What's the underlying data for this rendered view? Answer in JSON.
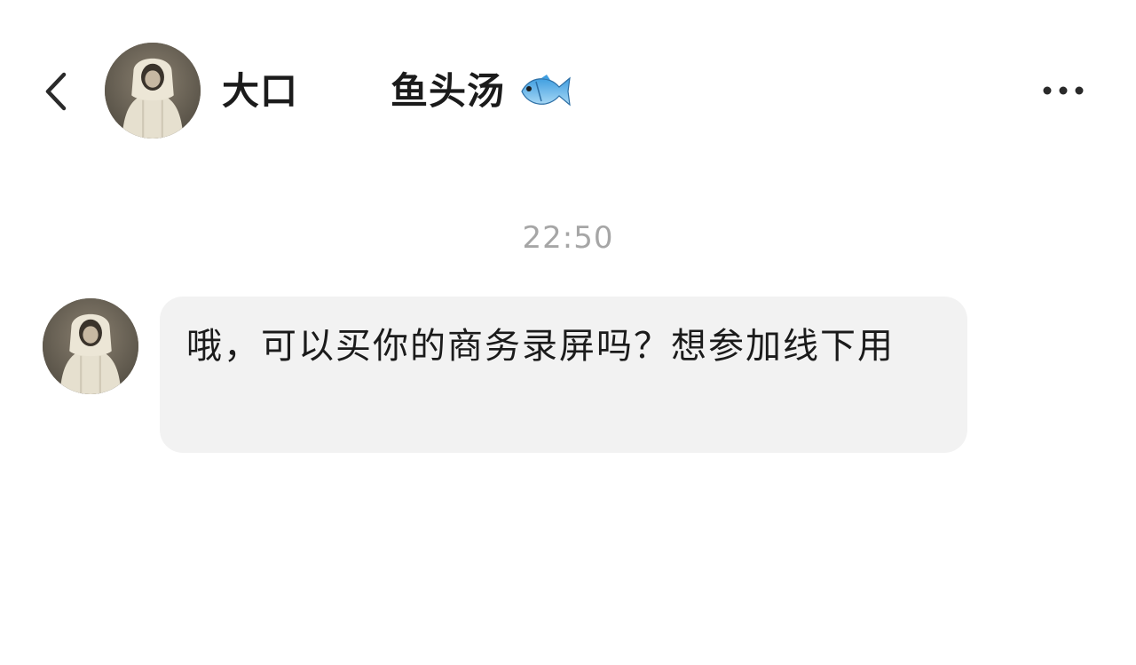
{
  "header": {
    "back_icon": "chevron-left-icon",
    "contact_name": "大口",
    "group_name": "鱼头汤",
    "group_emoji_icon": "fish-icon",
    "more_icon": "more-dots-icon"
  },
  "conversation": {
    "timestamp": "22:50",
    "messages": [
      {
        "sender": "大口",
        "text": "哦，可以买你的商务录屏吗？想参加线下用"
      }
    ]
  },
  "colors": {
    "background": "#ffffff",
    "bubble": "#f2f2f2",
    "timestamp": "#a6a6a6",
    "text": "#1b1b1b"
  }
}
